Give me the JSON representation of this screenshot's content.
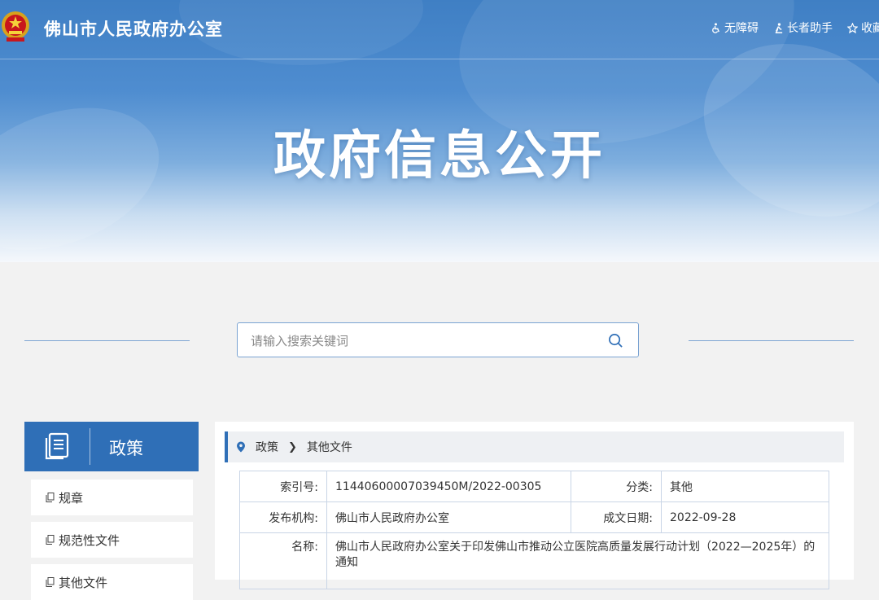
{
  "header": {
    "site_title": "佛山市人民政府办公室",
    "links": [
      {
        "label": "无障碍",
        "icon": "accessibility-icon"
      },
      {
        "label": "长者助手",
        "icon": "elder-assist-icon"
      },
      {
        "label": "收藏",
        "icon": "star-icon"
      }
    ]
  },
  "banner": {
    "title": "政府信息公开"
  },
  "search": {
    "placeholder": "请输入搜索关键词"
  },
  "sidebar": {
    "title": "政策",
    "items": [
      {
        "label": "规章"
      },
      {
        "label": "规范性文件"
      },
      {
        "label": "其他文件"
      }
    ]
  },
  "breadcrumb": [
    "政策",
    "其他文件"
  ],
  "info": {
    "index_label": "索引号:",
    "index_value": "11440600007039450M/2022-00305",
    "category_label": "分类:",
    "category_value": "其他",
    "publisher_label": "发布机构:",
    "publisher_value": "佛山市人民政府办公室",
    "date_label": "成文日期:",
    "date_value": "2022-09-28",
    "name_label": "名称:",
    "name_value": "佛山市人民政府办公室关于印发佛山市推动公立医院高质量发展行动计划（2022—2025年）的通知"
  },
  "colors": {
    "primary": "#2f6fb7",
    "banner_top": "#3f7fc4",
    "page_bg": "#f2f2f2"
  }
}
